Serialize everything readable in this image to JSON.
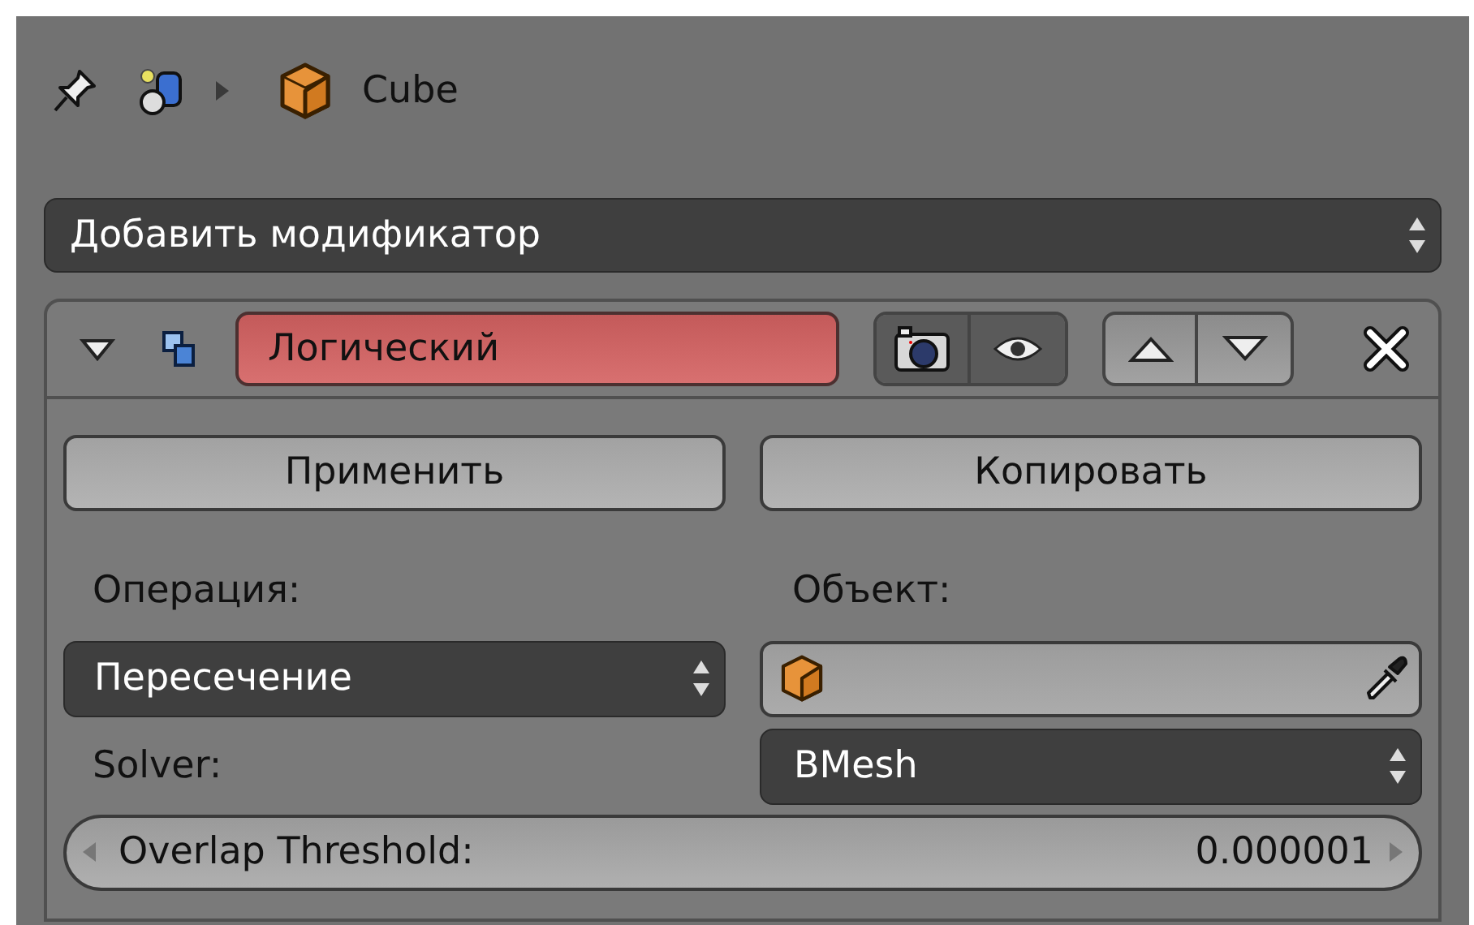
{
  "header": {
    "object_name": "Cube"
  },
  "add_modifier": {
    "label": "Добавить модификатор"
  },
  "modifier": {
    "expanded": true,
    "name": "Логический",
    "render_enabled": true,
    "viewport_enabled": true,
    "buttons": [
      "Применить",
      "Копировать"
    ],
    "operation": {
      "label": "Операция:",
      "value": "Пересечение"
    },
    "object": {
      "label": "Объект:"
    },
    "solver": {
      "label": "Solver:",
      "value": "BMesh"
    },
    "overlap": {
      "label": "Overlap Threshold:",
      "value": "0.000001"
    }
  }
}
